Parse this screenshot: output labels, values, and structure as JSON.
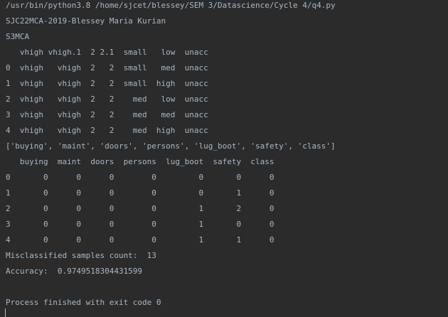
{
  "console": {
    "lines": [
      "/usr/bin/python3.8 /home/sjcet/blessey/SEM 3/Datascience/Cycle 4/q4.py",
      "SJC22MCA-2019-Blessey Maria Kurian",
      "S3MCA",
      "   vhigh vhigh.1  2 2.1  small   low  unacc",
      "0  vhigh   vhigh  2   2  small   med  unacc",
      "1  vhigh   vhigh  2   2  small  high  unacc",
      "2  vhigh   vhigh  2   2    med   low  unacc",
      "3  vhigh   vhigh  2   2    med   med  unacc",
      "4  vhigh   vhigh  2   2    med  high  unacc",
      "['buying', 'maint', 'doors', 'persons', 'lug_boot', 'safety', 'class']",
      "   buying  maint  doors  persons  lug_boot  safety  class",
      "0       0      0      0        0         0       0      0",
      "1       0      0      0        0         0       1      0",
      "2       0      0      0        0         1       2      0",
      "3       0      0      0        0         1       0      0",
      "4       0      0      0        0         1       1      0",
      "Misclassified samples count:  13",
      "Accuracy:  0.9749518304431599",
      "",
      "Process finished with exit code 0"
    ]
  }
}
